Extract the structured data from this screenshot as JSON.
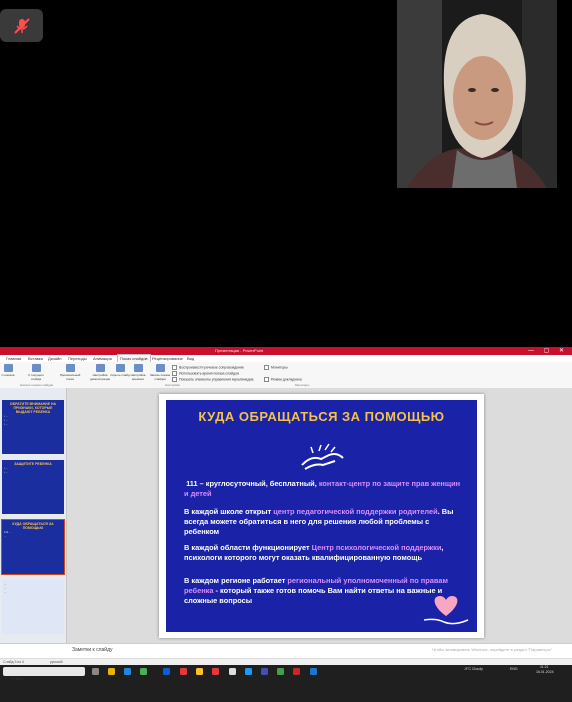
{
  "call": {
    "mute_icon": "microphone-off-icon",
    "participant_video_icon": "camera-video-tile"
  },
  "window": {
    "title": "Презентация - PowerPoint",
    "controls": "— ▢ ✕"
  },
  "ribbon": {
    "tabs": [
      "Главная",
      "Вставка",
      "Дизайн",
      "Переходы",
      "Анимация",
      "Показ слайдов",
      "Рецензирование",
      "Вид"
    ],
    "active_tab": "Показ слайдов",
    "buttons": [
      {
        "label": "С начала"
      },
      {
        "label": "С текущего слайда"
      },
      {
        "label": "Произвольный показ"
      },
      {
        "label": "Настройка демонстрации"
      },
      {
        "label": "Скрыть слайд"
      },
      {
        "label": "Настройка времени"
      },
      {
        "label": "Запись показа слайдов"
      }
    ],
    "checks": [
      "Воспроизвести речевое сопровождение",
      "Использовать время показа слайдов",
      "Показать элементы управления мультимедиа",
      "Мониторы",
      "Режим докладчика"
    ],
    "group_labels": [
      "Начало показа слайдов",
      "Настройка",
      "Мониторы"
    ]
  },
  "thumbnails": [
    {
      "title": "ОБРАТИТЕ ВНИМАНИЕ НА ПРИЗНАКИ, КОТОРЫЕ ВЫДАЮТ РЕБЕНКА",
      "lines": [
        "• ...",
        "• ...",
        "• ..."
      ]
    },
    {
      "title": "ЗАЩИТИТЕ РЕБЕНКА",
      "lines": [
        "• ...",
        "• ..."
      ]
    },
    {
      "title": "КУДА ОБРАЩАТЬСЯ ЗА ПОМОЩЬЮ",
      "lines": [
        "111 ...",
        "..."
      ]
    },
    {
      "title": "",
      "lines": [
        "...",
        "...",
        "..."
      ]
    }
  ],
  "slide": {
    "title": "КУДА ОБРАЩАТЬСЯ ЗА ПОМОЩЬЮ",
    "p1_plain": "111 – круглосуточный, бесплатный, ",
    "p1_hl": "контакт-центр по защите прав женщин и детей",
    "p2_plain1": "В каждой школе открыт ",
    "p2_hl": "центр педагогической поддержки родителей",
    "p2_plain2": ". Вы всегда можете обратиться в него для решения любой проблемы с ребенком",
    "p3_plain1": "В каждой области функционирует ",
    "p3_hl": "Центр психологической поддержки",
    "p3_plain2": ", психологи которого могут оказать квалифицированную помощь",
    "p4_plain1": "В каждом регионе работает ",
    "p4_hl": "региональный уполномоченный по правам ребенка",
    "p4_plain2": " - который также готов помочь Вам найти ответы на важные и сложные вопросы"
  },
  "notes": {
    "placeholder": "Заметки к слайду",
    "hint": "Чтобы активировать Windows, перейдите в раздел \"Параметры\""
  },
  "status": {
    "left": "Слайд 3 из 4",
    "lang": "русский"
  },
  "taskbar": {
    "search_placeholder": "Поиск",
    "weather": "-9°C Cloudy",
    "lang": "ENG",
    "time": "11:21",
    "date": "16.01.2024"
  },
  "colors": {
    "slide_bg": "#1a23a8",
    "title": "#f2c14e",
    "highlight": "#d98cff",
    "ribbon_accent": "#c8102e"
  }
}
